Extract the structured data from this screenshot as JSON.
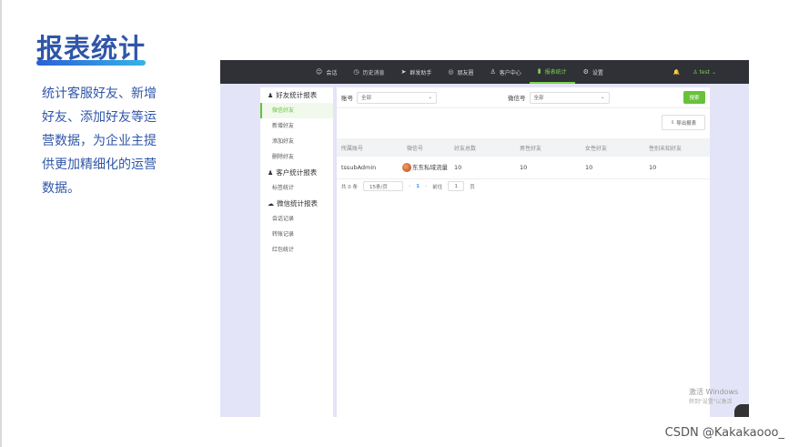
{
  "slide": {
    "title": "报表统计",
    "description": "统计客服好友、新增好友、添加好友等运营数据，为企业主提供更加精细化的运营数据。",
    "watermark": "CSDN @Kakakaooo_"
  },
  "topbar": {
    "nav": [
      {
        "label": "会话",
        "icon": "chat-icon",
        "glyph": "☺"
      },
      {
        "label": "历史消息",
        "icon": "clock-icon",
        "glyph": "◷"
      },
      {
        "label": "群发助手",
        "icon": "send-icon",
        "glyph": "➤"
      },
      {
        "label": "朋友圈",
        "icon": "moments-icon",
        "glyph": "◎"
      },
      {
        "label": "客户中心",
        "icon": "user-icon",
        "glyph": "♙"
      },
      {
        "label": "报表统计",
        "icon": "bar-chart-icon",
        "glyph": "▮",
        "active": true
      },
      {
        "label": "设置",
        "icon": "settings-icon",
        "glyph": "⚙"
      }
    ],
    "user": "test",
    "accent": "#7bd14f"
  },
  "sidebar": {
    "groups": [
      {
        "label": "好友统计报表",
        "icon": "user-icon",
        "items": [
          {
            "label": "微信好友",
            "active": true
          },
          {
            "label": "新增好友"
          },
          {
            "label": "添加好友"
          },
          {
            "label": "删除好友"
          }
        ]
      },
      {
        "label": "客户统计报表",
        "icon": "user-icon",
        "items": [
          {
            "label": "标签统计"
          }
        ]
      },
      {
        "label": "微信统计报表",
        "icon": "wechat-icon",
        "items": [
          {
            "label": "会话记录"
          },
          {
            "label": "转账记录"
          },
          {
            "label": "红包统计"
          }
        ]
      }
    ]
  },
  "filters": {
    "account_label": "账号",
    "account_value": "全部",
    "wechat_label": "微信号",
    "wechat_value": "全部",
    "search_label": "搜索",
    "export_label": "导出报表"
  },
  "table": {
    "columns": [
      "所属账号",
      "微信号",
      "好友总数",
      "男性好友",
      "女性好友",
      "性别未知好友"
    ],
    "rows": [
      [
        "tssubAdmin",
        "东东私域流量",
        "10",
        "10",
        "10",
        "10"
      ]
    ]
  },
  "pagination": {
    "total": "共 0 条",
    "page_size": "15条/页",
    "current": "1",
    "goto_label": "前往",
    "goto_value": "1",
    "page_suffix": "页"
  },
  "windows_activation": {
    "line1": "激活 Windows",
    "line2": "转到\"设置\"以激活"
  }
}
